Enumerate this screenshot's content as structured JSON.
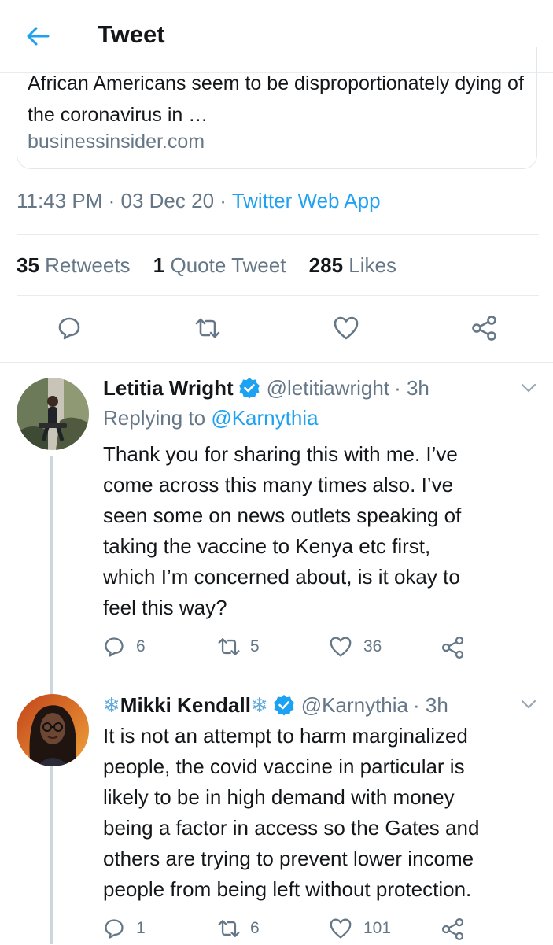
{
  "header": {
    "title": "Tweet"
  },
  "link_card": {
    "title": "African Americans seem to be disproportionately dying of the coronavirus in …",
    "domain": "businessinsider.com"
  },
  "tweet_meta": {
    "time": "11:43 PM",
    "date": "03 Dec 20",
    "separator": "·",
    "source": "Twitter Web App"
  },
  "stats": {
    "retweets_count": "35",
    "retweets_label": "Retweets",
    "quotes_count": "1",
    "quotes_label": "Quote Tweet",
    "likes_count": "285",
    "likes_label": "Likes"
  },
  "replies": [
    {
      "name": "Letitia Wright",
      "handle": "@letitiawright",
      "time": "· 3h",
      "replying_prefix": "Replying to",
      "replying_to": "@Karnythia",
      "lines": [
        "Thank you for sharing this with me. I’ve",
        "come across this many times also. I’ve",
        "seen some on news outlets speaking of",
        "taking the vaccine to Kenya etc first,",
        "which I’m concerned about, is it okay to",
        "feel this way?"
      ],
      "replies_count": "6",
      "retweets_count": "5",
      "likes_count": "36"
    },
    {
      "name_prefix": "❄",
      "name": "Mikki Kendall",
      "name_suffix": "❄",
      "handle": "@Karnythia",
      "time": "· 3h",
      "lines": [
        "It is not an attempt to harm marginalized",
        "people, the covid vaccine in particular is",
        "likely to be in high demand with money",
        "being a factor in access so the Gates and",
        "others are trying to prevent lower income",
        "people from being left without protection."
      ],
      "replies_count": "1",
      "retweets_count": "6",
      "likes_count": "101"
    }
  ],
  "colors": {
    "accent": "#1da1f2",
    "secondary_text": "#657786",
    "verified": "#1da1f2"
  },
  "icons": [
    "back-arrow-icon",
    "reply-icon",
    "retweet-icon",
    "like-icon",
    "share-icon",
    "verified-icon",
    "chevron-down-icon",
    "snowflake-icon"
  ]
}
